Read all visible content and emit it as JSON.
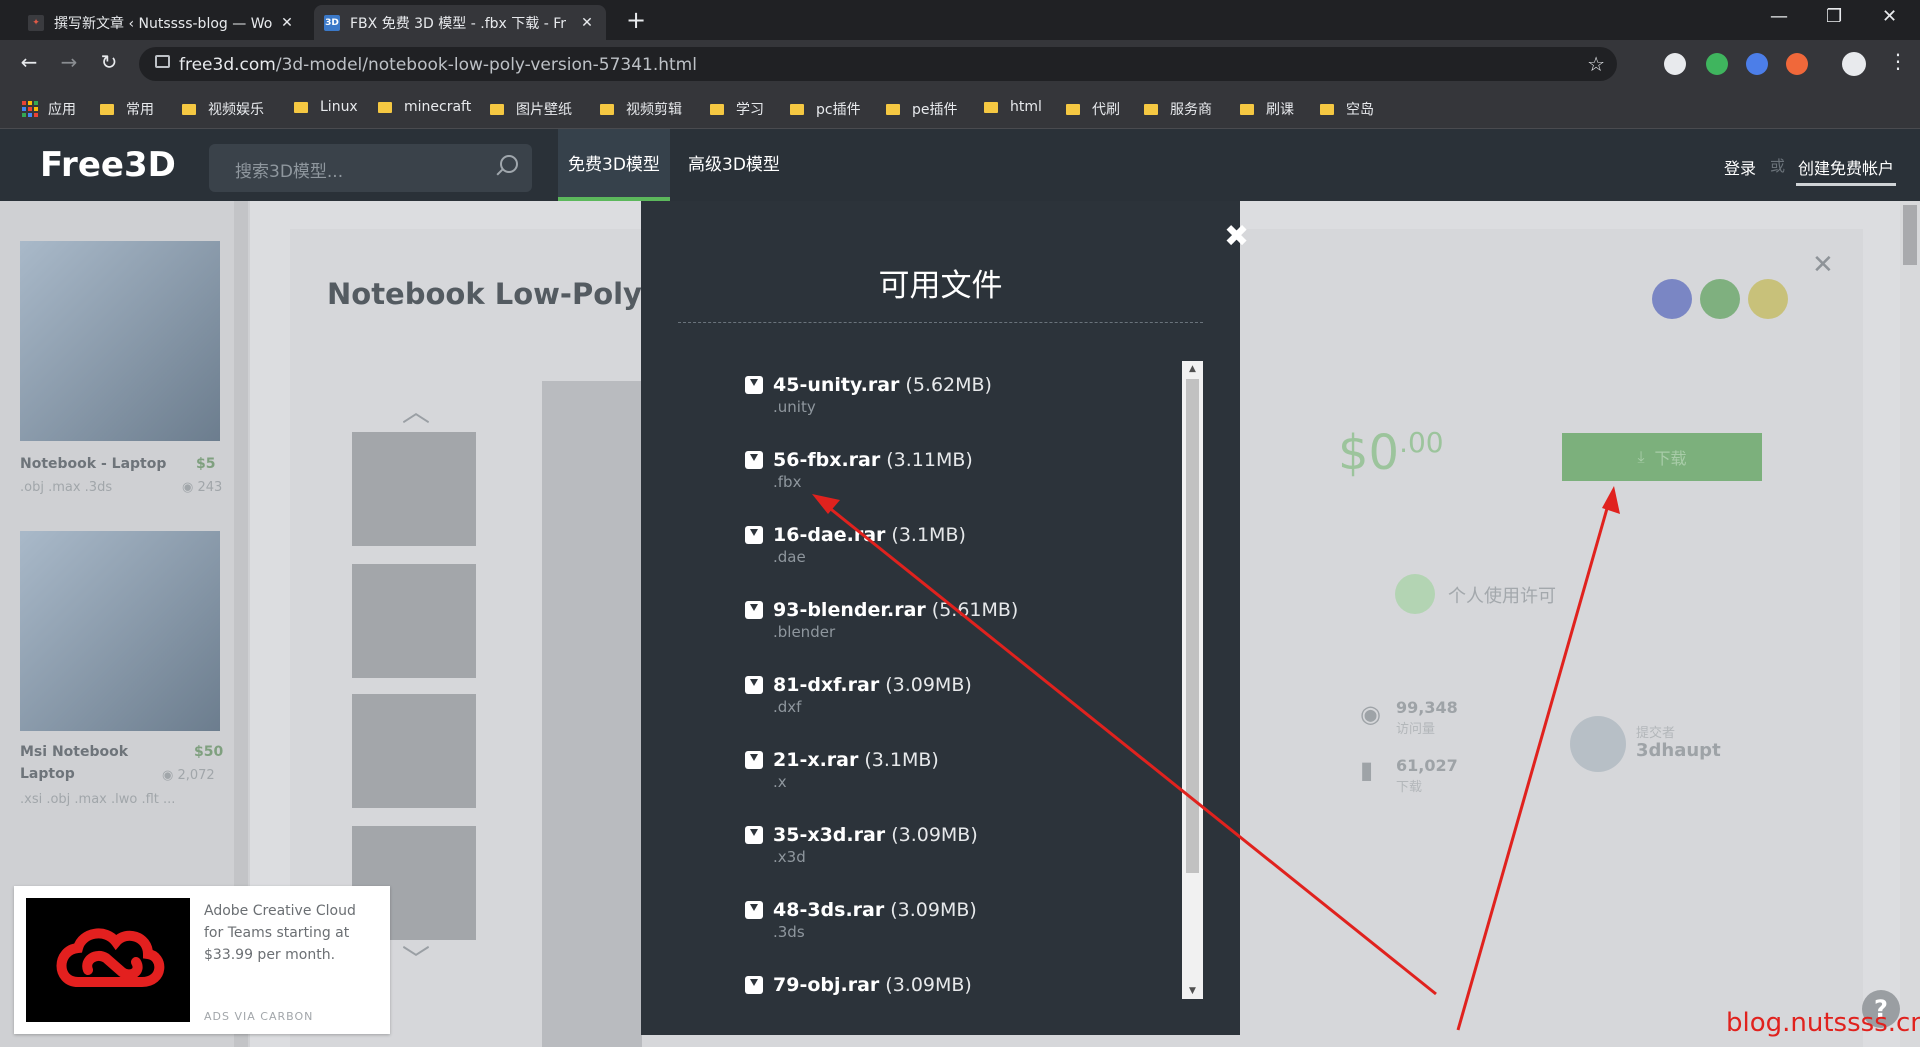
{
  "browser": {
    "tabs": [
      {
        "title": "撰写新文章 ‹ Nutssss-blog — Wo",
        "close": "✕"
      },
      {
        "title": "FBX 免费 3D 模型 - .fbx 下载 - Fr",
        "favicon": "3D",
        "close": "✕"
      }
    ],
    "new_tab": "+",
    "window_controls": {
      "minimize": "—",
      "restore": "❐",
      "close": "✕"
    },
    "url_host": "free3d.com",
    "url_path": "/3d-model/notebook-low-poly-version-57341.html",
    "bookmarks": [
      "应用",
      "常用",
      "视频娱乐",
      "Linux",
      "minecraft",
      "图片壁纸",
      "视频剪辑",
      "学习",
      "pc插件",
      "pe插件",
      "html",
      "代刷",
      "服务商",
      "刷课",
      "空岛"
    ]
  },
  "site": {
    "logo": "Free3D",
    "search_placeholder": "搜索3D模型...",
    "nav": [
      "免费3D模型",
      "高级3D模型"
    ],
    "login": "登录",
    "or": "或",
    "signup": "创建免费帐户"
  },
  "sidebar": {
    "cards": [
      {
        "title": "Notebook - Laptop",
        "price": "$5",
        "formats": ".obj .max .3ds",
        "views": "243"
      },
      {
        "title": "Msi Notebook",
        "title2": "Laptop",
        "price": "$50",
        "formats": ".xsi .obj .max .lwo .flt ...",
        "views": "2,072"
      }
    ]
  },
  "product": {
    "title": "Notebook Low-Poly Ve",
    "price_main": "$0",
    "price_cents": ".00",
    "download_label": "下载",
    "license": "个人使用许可",
    "views": "99,348",
    "views_label": "访问量",
    "downloads": "61,027",
    "downloads_label": "下载",
    "author_label": "提交者",
    "author": "3dhaupt"
  },
  "ad": {
    "text": "Adobe Creative Cloud for Teams starting at $33.99 per month.",
    "via": "ADS VIA CARBON"
  },
  "modal": {
    "title": "可用文件",
    "close": "✖",
    "files": [
      {
        "name": "45-unity.rar",
        "size": "(5.62MB)",
        "ext": ".unity"
      },
      {
        "name": "56-fbx.rar",
        "size": "(3.11MB)",
        "ext": ".fbx"
      },
      {
        "name": "16-dae.rar",
        "size": "(3.1MB)",
        "ext": ".dae"
      },
      {
        "name": "93-blender.rar",
        "size": "(5.61MB)",
        "ext": ".blender"
      },
      {
        "name": "81-dxf.rar",
        "size": "(3.09MB)",
        "ext": ".dxf"
      },
      {
        "name": "21-x.rar",
        "size": "(3.1MB)",
        "ext": ".x"
      },
      {
        "name": "35-x3d.rar",
        "size": "(3.09MB)",
        "ext": ".x3d"
      },
      {
        "name": "48-3ds.rar",
        "size": "(3.09MB)",
        "ext": ".3ds"
      },
      {
        "name": "79-obj.rar",
        "size": "(3.09MB)",
        "ext": ""
      }
    ]
  },
  "help": "?",
  "watermark": "blog.nutssss.cn",
  "colors": {
    "accent_green": "#5cb85c",
    "annotation_red": "#e0221e",
    "header_bg": "#2a3138",
    "modal_bg": "#2c333a"
  }
}
